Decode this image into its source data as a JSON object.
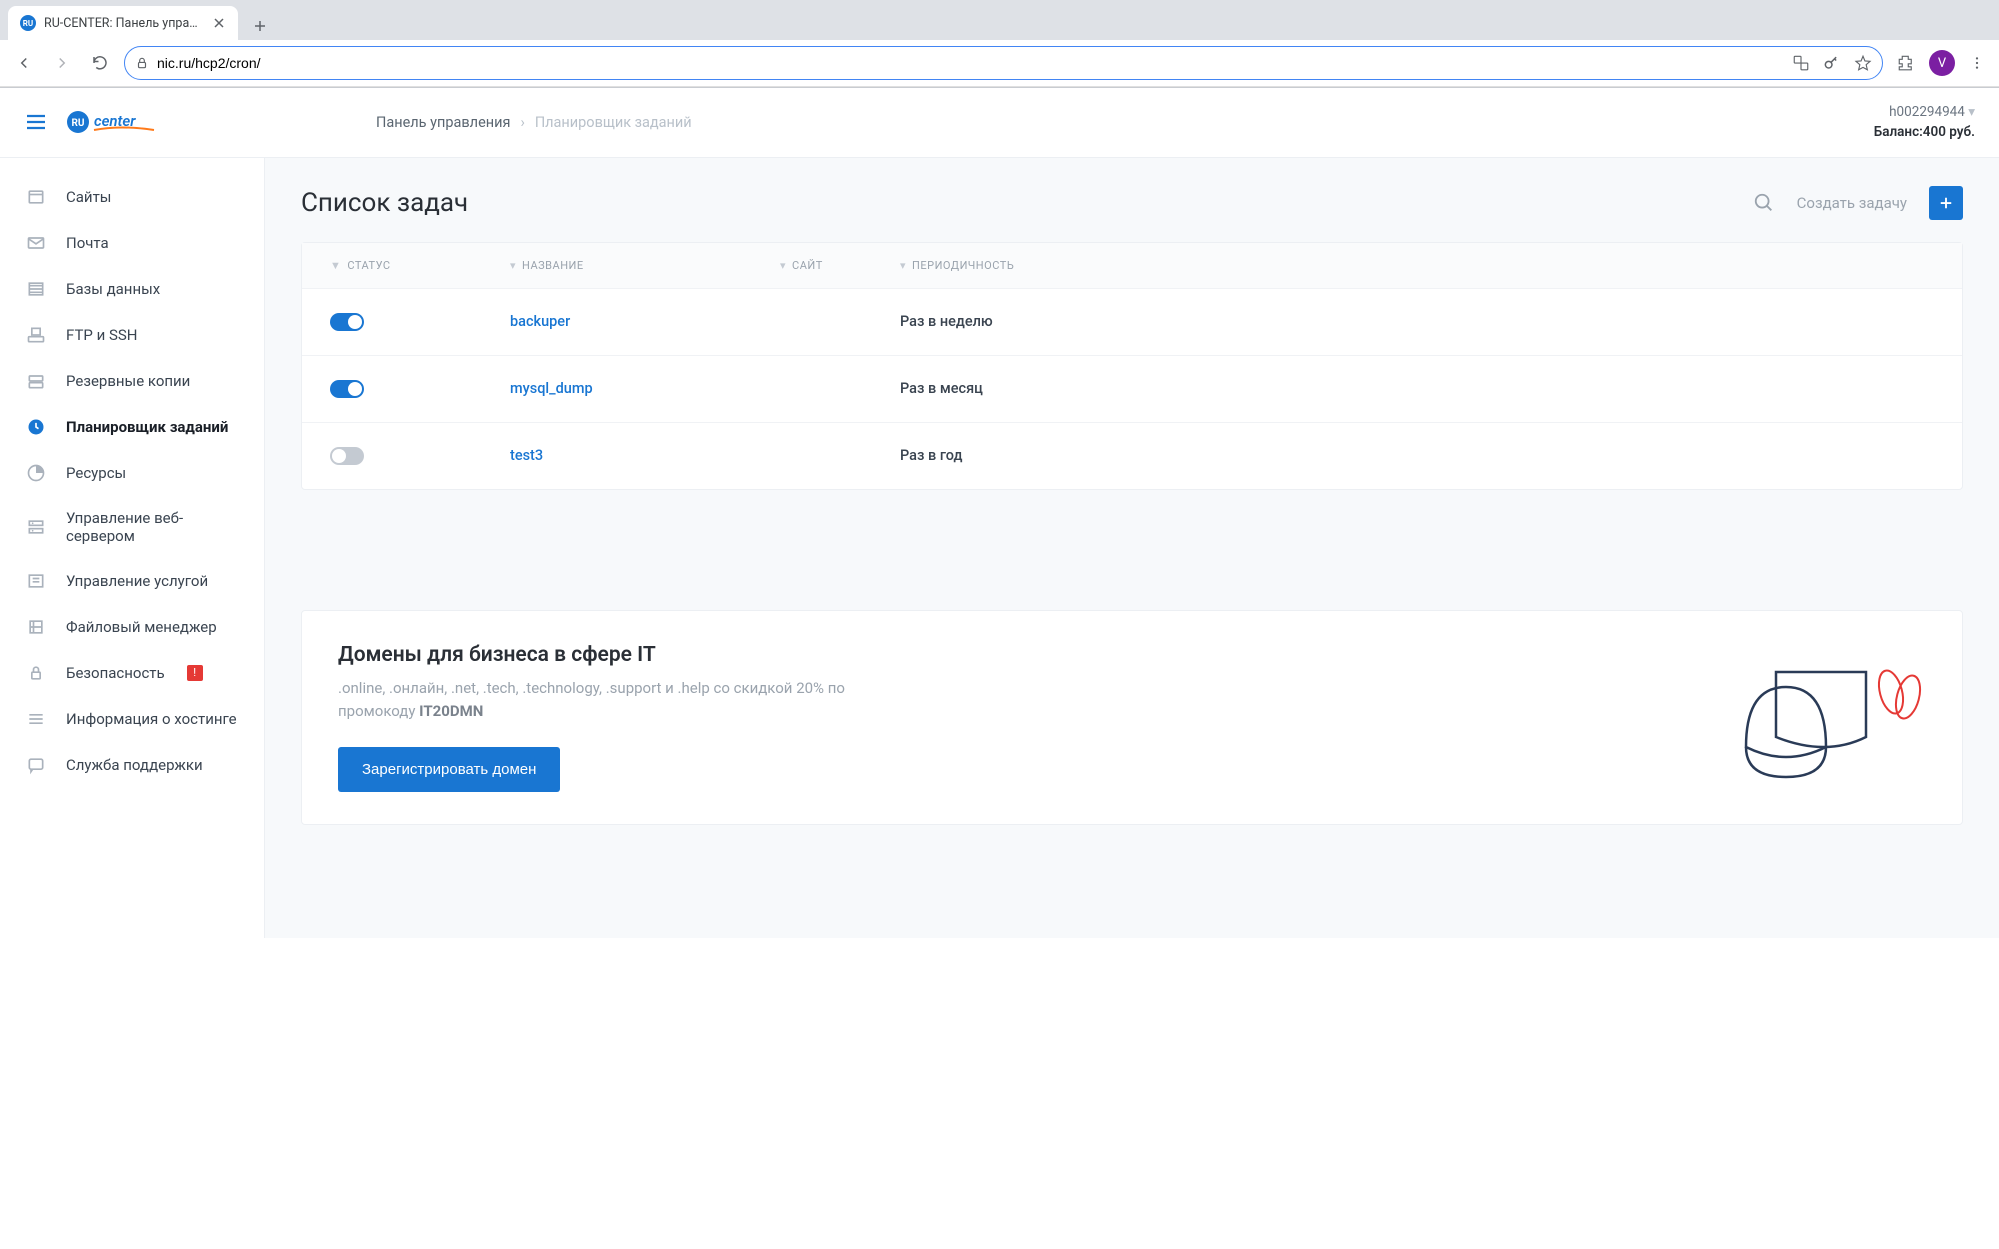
{
  "browser": {
    "tab_title": "RU-CENTER: Панель управле",
    "url": "nic.ru/hcp2/cron/",
    "avatar_initial": "V"
  },
  "header": {
    "breadcrumb_root": "Панель управления",
    "breadcrumb_current": "Планировщик заданий",
    "account_id": "h002294944",
    "balance_label": "Баланс:",
    "balance_value": "400 руб."
  },
  "sidebar": {
    "items": [
      {
        "label": "Сайты",
        "icon": "sites"
      },
      {
        "label": "Почта",
        "icon": "mail"
      },
      {
        "label": "Базы данных",
        "icon": "db"
      },
      {
        "label": "FTP и SSH",
        "icon": "ftp"
      },
      {
        "label": "Резервные копии",
        "icon": "backup"
      },
      {
        "label": "Планировщик заданий",
        "icon": "clock",
        "active": true
      },
      {
        "label": "Ресурсы",
        "icon": "resources"
      },
      {
        "label": "Управление веб-сервером",
        "icon": "server"
      },
      {
        "label": "Управление услугой",
        "icon": "service"
      },
      {
        "label": "Файловый менеджер",
        "icon": "files"
      },
      {
        "label": "Безопасность",
        "icon": "security",
        "alert": "!"
      },
      {
        "label": "Информация о хостинге",
        "icon": "info"
      },
      {
        "label": "Служба поддержки",
        "icon": "support"
      }
    ]
  },
  "page": {
    "title": "Список задач",
    "create_label": "Создать задачу",
    "columns": {
      "status": "СТАТУС",
      "name": "НАЗВАНИЕ",
      "site": "САЙТ",
      "frequency": "ПЕРИОДИЧНОСТЬ"
    },
    "tasks": [
      {
        "enabled": true,
        "name": "backuper",
        "site": "",
        "frequency": "Раз в неделю"
      },
      {
        "enabled": true,
        "name": "mysql_dump",
        "site": "",
        "frequency": "Раз в месяц"
      },
      {
        "enabled": false,
        "name": "test3",
        "site": "",
        "frequency": "Раз в год"
      }
    ]
  },
  "promo": {
    "title": "Домены для бизнеса в сфере IT",
    "desc_prefix": ".online, .онлайн, .net, .tech, .technology, .support и .help со скидкой 20% по промокоду ",
    "promo_code": "IT20DMN",
    "cta": "Зарегистрировать домен"
  }
}
